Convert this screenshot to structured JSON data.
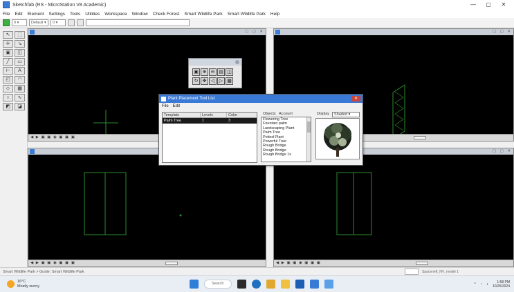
{
  "window": {
    "title": "Sketchfab (RS - MicroStation V8 Academic)",
    "controls": [
      "—",
      "▢",
      "✕"
    ]
  },
  "menubar": [
    "File",
    "Edit",
    "Element",
    "Settings",
    "Tools",
    "Utilities",
    "Workspace",
    "Window",
    "Check Forest",
    "Smart Wildlife Park",
    "Smart Wildlife Park",
    "Help"
  ],
  "toolbar": {
    "select1": "0 ▾",
    "select2": "Default ▾",
    "select3": "0 ▾"
  },
  "object_dialog": {
    "title": "Plant Placement Tool List",
    "menu": [
      "File",
      "Edit"
    ],
    "columns": [
      "Template",
      "Levels",
      "Color"
    ],
    "selected_row": [
      "Palm Tree",
      "1",
      "3"
    ],
    "objects_label": "Objects",
    "objects_header": "Account",
    "objects": [
      "Flowering Tree",
      "Fountain palm",
      "Landscaping Plant",
      "Palm Tree",
      "Potted Plant",
      "Powerful Tree",
      "Rough Bridge",
      "Rough Bridge",
      "Rough Bridge 1s"
    ],
    "display_label": "Display",
    "display_value": "Shaded ▾",
    "close_glyph": "✕"
  },
  "statusbar": {
    "left": "Smart Wildlife Park > Guide: Smart Wildlife Park",
    "right": "Spaceneft_NV_model 1"
  },
  "taskbar": {
    "weather_temp": "16°C",
    "weather_desc": "Mostly sunny",
    "search": "Search",
    "time": "1:58 PM",
    "date": "10/25/2024"
  }
}
